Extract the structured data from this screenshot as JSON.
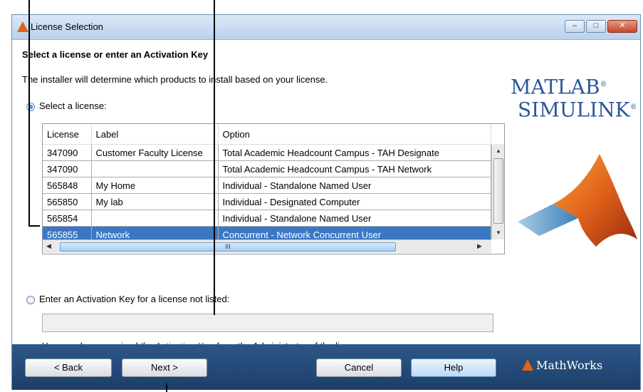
{
  "window": {
    "title": "License Selection",
    "controls": {
      "minimize": "–",
      "maximize": "□",
      "close": "✕"
    }
  },
  "heading": "Select a license or enter an Activation Key",
  "subtext": "The installer will determine which products to install based on your license.",
  "select_license_label": "Select a license:",
  "table": {
    "columns": [
      "License",
      "Label",
      "Option"
    ],
    "rows": [
      {
        "license": "347090",
        "label": "Customer Faculty License",
        "option": "Total Academic Headcount Campus - TAH Designate"
      },
      {
        "license": "347090",
        "label": "",
        "option": "Total Academic Headcount Campus - TAH Network"
      },
      {
        "license": "565848",
        "label": "My Home",
        "option": "Individual - Standalone Named User"
      },
      {
        "license": "565850",
        "label": "My lab",
        "option": "Individual - Designated Computer"
      },
      {
        "license": "565854",
        "label": "",
        "option": "Individual - Standalone Named User"
      },
      {
        "license": "565855",
        "label": "Network",
        "option": "Concurrent - Network Concurrent User"
      }
    ],
    "selected_index": 5,
    "hscroll_thumb": "III"
  },
  "activation_label": "Enter an Activation Key for a license not listed:",
  "activation_value": "",
  "hint": {
    "before": "You may have received the ",
    "link": "Activation Key",
    "after": " from the Administrator of the license."
  },
  "brand": {
    "line1": "MATLAB",
    "line2": "SIMULINK",
    "reg": "®"
  },
  "buttons": {
    "back": "< Back",
    "next": "Next >",
    "cancel": "Cancel",
    "help": "Help"
  },
  "footer_logo": "MathWorks",
  "colors": {
    "selection": "#3a78c4",
    "footer": "#2d5789",
    "brand_blue": "#2b5797",
    "membrane": "#e0621b"
  }
}
